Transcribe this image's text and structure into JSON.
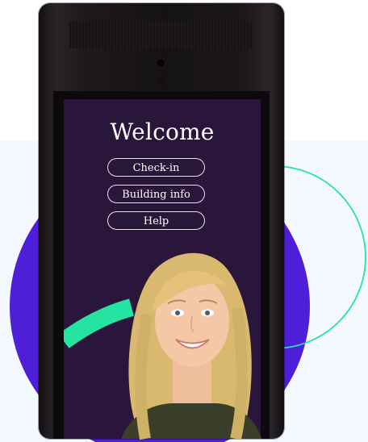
{
  "screen": {
    "title": "Welcome",
    "buttons": [
      {
        "label": "Check-in"
      },
      {
        "label": "Building info"
      },
      {
        "label": "Help"
      }
    ]
  },
  "colors": {
    "background": "#ffffff",
    "panel": "#f4f8ff",
    "brand_purple": "#4f1ed9",
    "screen_bg": "#29163a",
    "accent_green": "#25e3a0",
    "kiosk_body": "#161317"
  },
  "icons": {
    "camera": "camera-icon"
  }
}
